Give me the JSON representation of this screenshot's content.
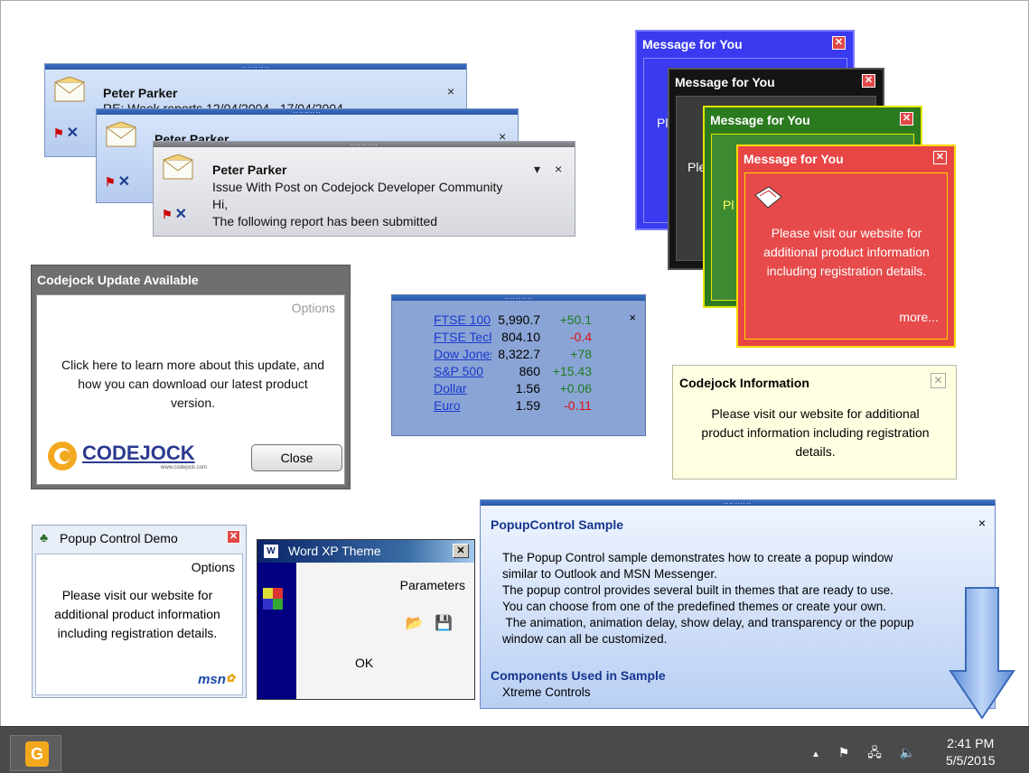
{
  "outlook_popups": [
    {
      "sender": "Peter Parker",
      "subject": "RE: Week reports 12/04/2004...17/04/2004"
    },
    {
      "sender": "Peter Parker",
      "subject": ""
    },
    {
      "sender": "Peter Parker",
      "subject": "Issue With Post on Codejock Developer Community",
      "line3": "Hi,",
      "line4": "The following report has been submitted"
    }
  ],
  "close_glyph": "×",
  "dropdown_glyph": "▾",
  "message_popups": {
    "title": "Message for You",
    "body": "Please visit our website for additional product information including registration details.",
    "more_link": "more...",
    "partial_1": "Pl",
    "partial_2": "Ple",
    "partial_3": "Pl",
    "colors": [
      "#3a3af0",
      "#141414",
      "#2b7a1f",
      "#e84545"
    ]
  },
  "codejock_update": {
    "title": "Codejock Update Available",
    "options": "Options",
    "body": "Click here to learn more about this update, and how you can download our latest product version.",
    "logo_text": "CODEJOCK",
    "logo_url": "www.codejock.com",
    "close_button": "Close"
  },
  "stock_popup": {
    "rows": [
      {
        "name": "FTSE 100",
        "value": "5,990.7",
        "change": "+50.1",
        "up": true
      },
      {
        "name": "FTSE Tech",
        "value": "804.10",
        "change": "-0.4",
        "up": false
      },
      {
        "name": "Dow Jones",
        "value": "8,322.7",
        "change": "+78",
        "up": true
      },
      {
        "name": "S&P 500",
        "value": "860",
        "change": "+15.43",
        "up": true
      },
      {
        "name": "Dollar",
        "value": "1.56",
        "change": "+0.06",
        "up": true
      },
      {
        "name": "Euro",
        "value": "1.59",
        "change": "-0.11",
        "up": false
      }
    ]
  },
  "codejock_info": {
    "title": "Codejock Information",
    "body": "Please visit our website for additional product information including registration details."
  },
  "popup_demo": {
    "title": "Popup Control Demo",
    "options": "Options",
    "body": "Please visit our website for additional product information including registration details.",
    "logo_text": "msn"
  },
  "word_xp": {
    "title": "Word XP Theme",
    "parameters": "Parameters",
    "ok": "OK"
  },
  "popup_sample": {
    "title": "PopupControl Sample",
    "description": "The Popup Control sample demonstrates how to create a popup window\nsimilar to Outlook and MSN Messenger.\nThe popup control provides several built in themes that are ready to use.\nYou can choose from one of the predefined themes or create your own.\n The animation, animation delay, show delay, and transparency or the popup\nwindow can all be customized.",
    "components_title": "Components Used in Sample",
    "components_value": "Xtreme Controls"
  },
  "taskbar": {
    "time": "2:41 PM",
    "date": "5/5/2015"
  }
}
